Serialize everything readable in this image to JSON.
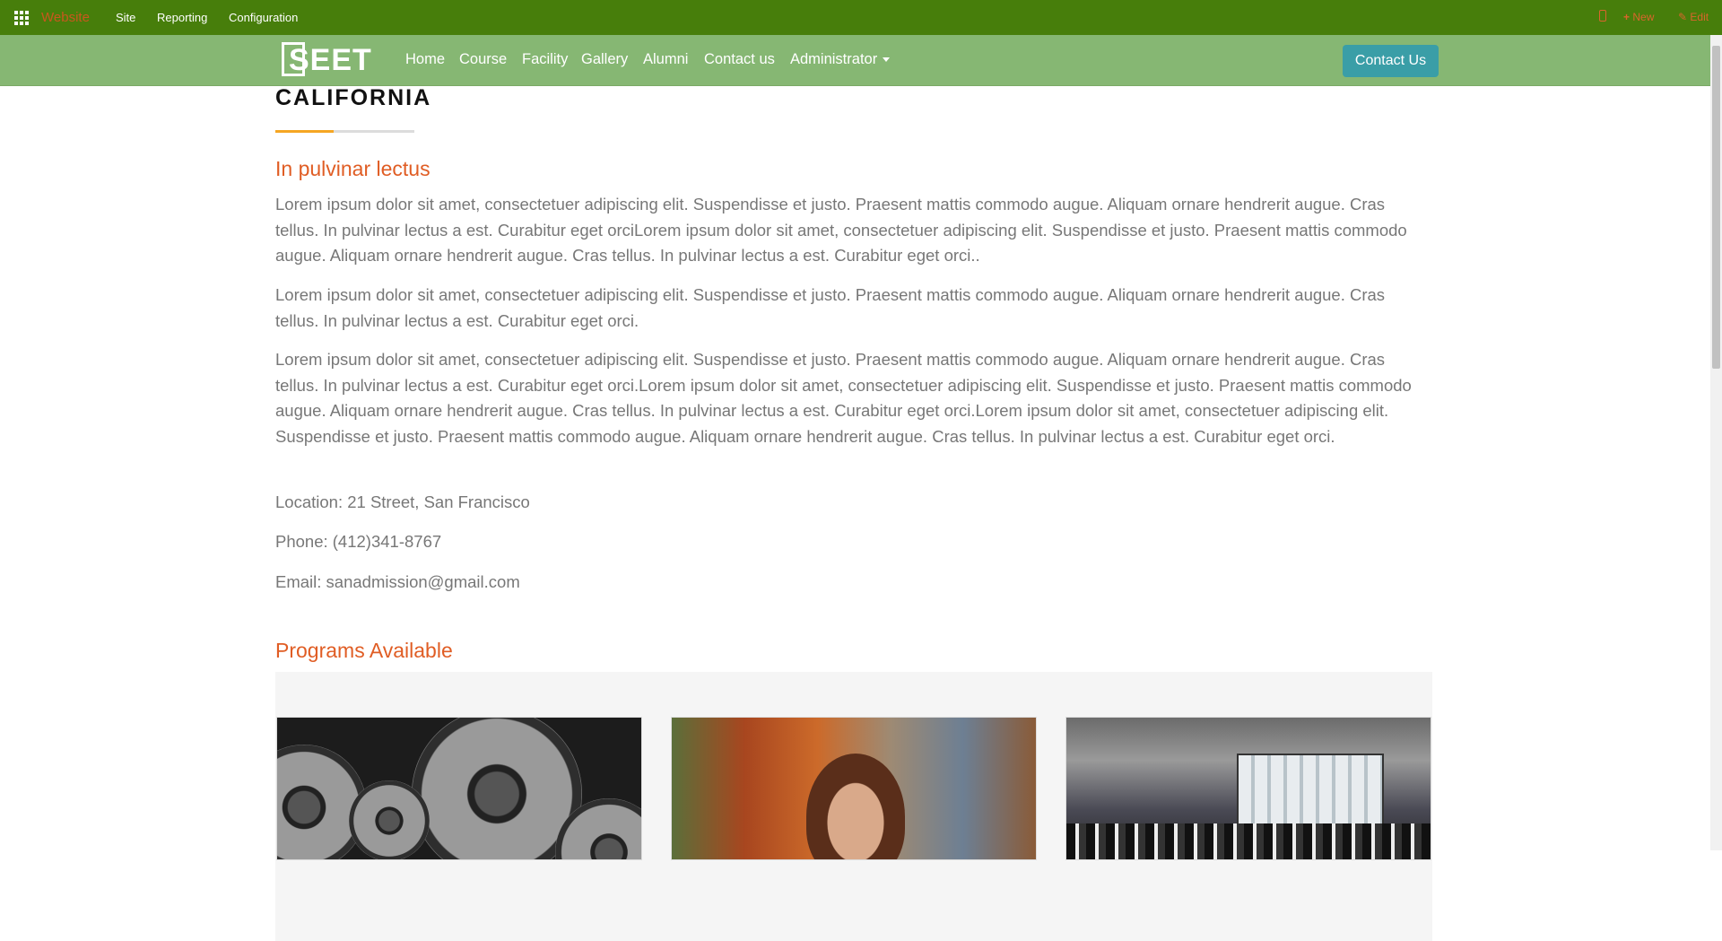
{
  "adminbar": {
    "brand": "Website",
    "menu": [
      "Site",
      "Reporting",
      "Configuration"
    ],
    "new_label": "New",
    "edit_label": "Edit",
    "color": "#477e0b",
    "accent": "#d9652c"
  },
  "navbar": {
    "logo_text": "SEET",
    "items": [
      "Home",
      "Course",
      "Facility",
      "Gallery",
      "Alumni",
      "Contact us",
      "Administrator"
    ],
    "contact_button": "Contact Us",
    "color": "#86b773",
    "button_color": "#3a9ea7"
  },
  "page": {
    "city_heading": "CALIFORNIA",
    "subheading": "In pulvinar lectus",
    "paragraphs": [
      "Lorem ipsum dolor sit amet, consectetuer adipiscing elit. Suspendisse et justo. Praesent mattis commodo augue. Aliquam ornare hendrerit augue. Cras tellus. In pulvinar lectus a est. Curabitur eget orciLorem ipsum dolor sit amet, consectetuer adipiscing elit. Suspendisse et justo. Praesent mattis commodo augue. Aliquam ornare hendrerit augue. Cras tellus. In pulvinar lectus a est. Curabitur eget orci..",
      "Lorem ipsum dolor sit amet, consectetuer adipiscing elit. Suspendisse et justo. Praesent mattis commodo augue. Aliquam ornare hendrerit augue. Cras tellus. In pulvinar lectus a est. Curabitur eget orci.",
      "Lorem ipsum dolor sit amet, consectetuer adipiscing elit. Suspendisse et justo. Praesent mattis commodo augue. Aliquam ornare hendrerit augue. Cras tellus. In pulvinar lectus a est. Curabitur eget orci.Lorem ipsum dolor sit amet, consectetuer adipiscing elit. Suspendisse et justo. Praesent mattis commodo augue. Aliquam ornare hendrerit augue. Cras tellus. In pulvinar lectus a est. Curabitur eget orci.Lorem ipsum dolor sit amet, consectetuer adipiscing elit. Suspendisse et justo. Praesent mattis commodo augue. Aliquam ornare hendrerit augue. Cras tellus. In pulvinar lectus a est. Curabitur eget orci."
    ],
    "location": "Location: 21 Street, San Francisco",
    "phone": "Phone: (412)341-8767",
    "email": "Email: sanadmission@gmail.com",
    "programs_title": "Programs Available",
    "heading_accent_color": "#e05d24",
    "underline_accent_color": "#f5a623"
  },
  "programs": [
    {
      "image": "gears-image"
    },
    {
      "image": "student-image"
    },
    {
      "image": "lab-image"
    }
  ]
}
